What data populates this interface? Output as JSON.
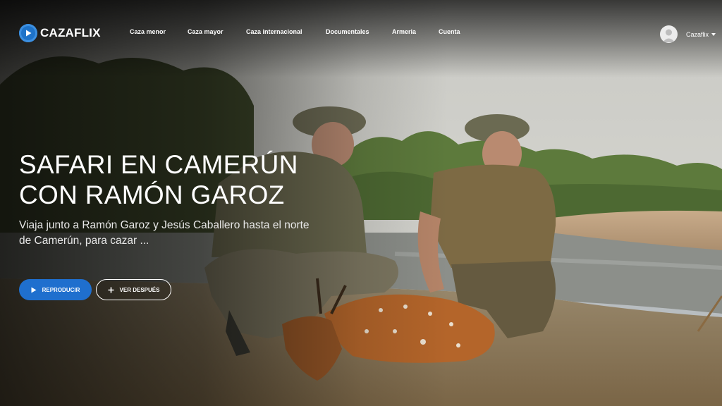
{
  "brand": {
    "name": "CAZAFLIX",
    "logo_color": "#1e73c9"
  },
  "nav": {
    "items": [
      {
        "label": "Caza menor"
      },
      {
        "label": "Caza mayor"
      },
      {
        "label": "Caza internacional"
      },
      {
        "label": "Documentales"
      },
      {
        "label": "Armeria"
      },
      {
        "label": "Cuenta"
      }
    ],
    "user": {
      "name": "Cazaflix",
      "icon": "chevron-down-icon"
    }
  },
  "hero": {
    "title_line1": "SAFARI EN CAMERÚN",
    "title_line2": "CON RAMÓN GAROZ",
    "description": "Viaja junto a Ramón Garoz y Jesús Caballero hasta el norte de Camerún, para cazar ...",
    "buttons": {
      "play": {
        "label": "REPRODUCIR",
        "icon": "play-icon",
        "color": "#1f6fce"
      },
      "later": {
        "label": "VER DESPUÉS",
        "icon": "plus-icon"
      }
    }
  }
}
